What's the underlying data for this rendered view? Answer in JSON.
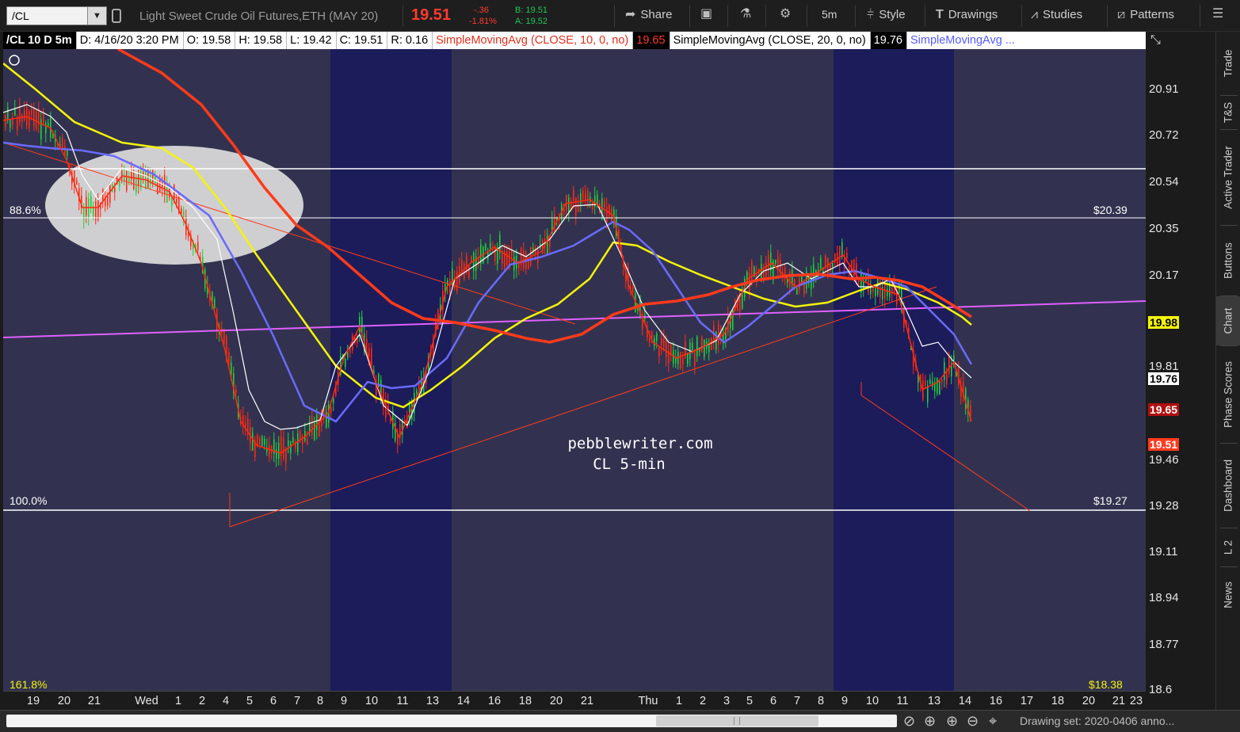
{
  "toolbar": {
    "symbol": "/CL",
    "description": "Light Sweet Crude Oil Futures,ETH (MAY 20)",
    "last": "19.51",
    "change": "-.36",
    "change_pct": "-1.81%",
    "bid": "B: 19.51",
    "ask": "A: 19.52",
    "share": "Share",
    "timeframe": "5m",
    "style": "Style",
    "drawings": "Drawings",
    "studies": "Studies",
    "patterns": "Patterns"
  },
  "infobar": {
    "symbol": "/CL 10 D 5m",
    "date": "D: 4/16/20 3:20 PM",
    "open": "O: 19.58",
    "high": "H: 19.58",
    "low": "L: 19.42",
    "close": "C: 19.51",
    "range": "R: 0.16",
    "sma1": "SimpleMovingAvg (CLOSE, 10, 0, no)",
    "sma1_val": "19.65",
    "sma2": "SimpleMovingAvg (CLOSE, 20, 0, no)",
    "sma2_val": "19.76",
    "sma3": "SimpleMovingAvg ..."
  },
  "chart": {
    "watermark_line1": "pebblewriter.com",
    "watermark_line2": "CL 5-min",
    "fib_labels": [
      {
        "pct": "88.6%",
        "price": "$20.39"
      },
      {
        "pct": "100.0%",
        "price": "$19.27"
      }
    ],
    "bottom_left_label": "161.8%",
    "bottom_right_label": "$18.38",
    "colors": {
      "background": "#323250",
      "session_shade": "#1c1c5a",
      "sma10": "#ff2a10",
      "sma20": "#ffffff",
      "sma50": "#6a6aff",
      "sma_yellow": "#f4f40a",
      "sma200": "#ff3a1a",
      "magenta_line": "#e060ff",
      "candle_up": "#1fd03a",
      "candle_down": "#ff2a10"
    }
  },
  "price_axis": {
    "ticks": [
      "20.91",
      "20.72",
      "20.54",
      "20.35",
      "20.17",
      "19.81",
      "19.46",
      "19.28",
      "19.11",
      "18.94",
      "18.77",
      "18.6"
    ],
    "tags": [
      {
        "value": "19.98",
        "bg": "#f4f40a",
        "fg": "#000000"
      },
      {
        "value": "19.76",
        "bg": "#ffffff",
        "fg": "#000000"
      },
      {
        "value": "19.65",
        "bg": "#b01010",
        "fg": "#ffffff"
      },
      {
        "value": "19.51",
        "bg": "#ff3b1f",
        "fg": "#ffffff"
      }
    ]
  },
  "time_axis": {
    "ticks": [
      "19",
      "20",
      "21",
      "Wed",
      "1",
      "2",
      "4",
      "5",
      "6",
      "7",
      "8",
      "9",
      "10",
      "11",
      "13",
      "14",
      "16",
      "18",
      "20",
      "21",
      "Thu",
      "1",
      "2",
      "3",
      "5",
      "6",
      "7",
      "8",
      "9",
      "10",
      "11",
      "13",
      "14",
      "16",
      "17",
      "18",
      "20",
      "21",
      "23"
    ]
  },
  "sidebar": {
    "tabs": [
      "Trade",
      "T&S",
      "Active Trader",
      "Buttons",
      "Chart",
      "Phase Scores",
      "Dashboard",
      "L 2",
      "News"
    ]
  },
  "statusbar": {
    "drawing_set": "Drawing set: 2020-0406 anno..."
  }
}
